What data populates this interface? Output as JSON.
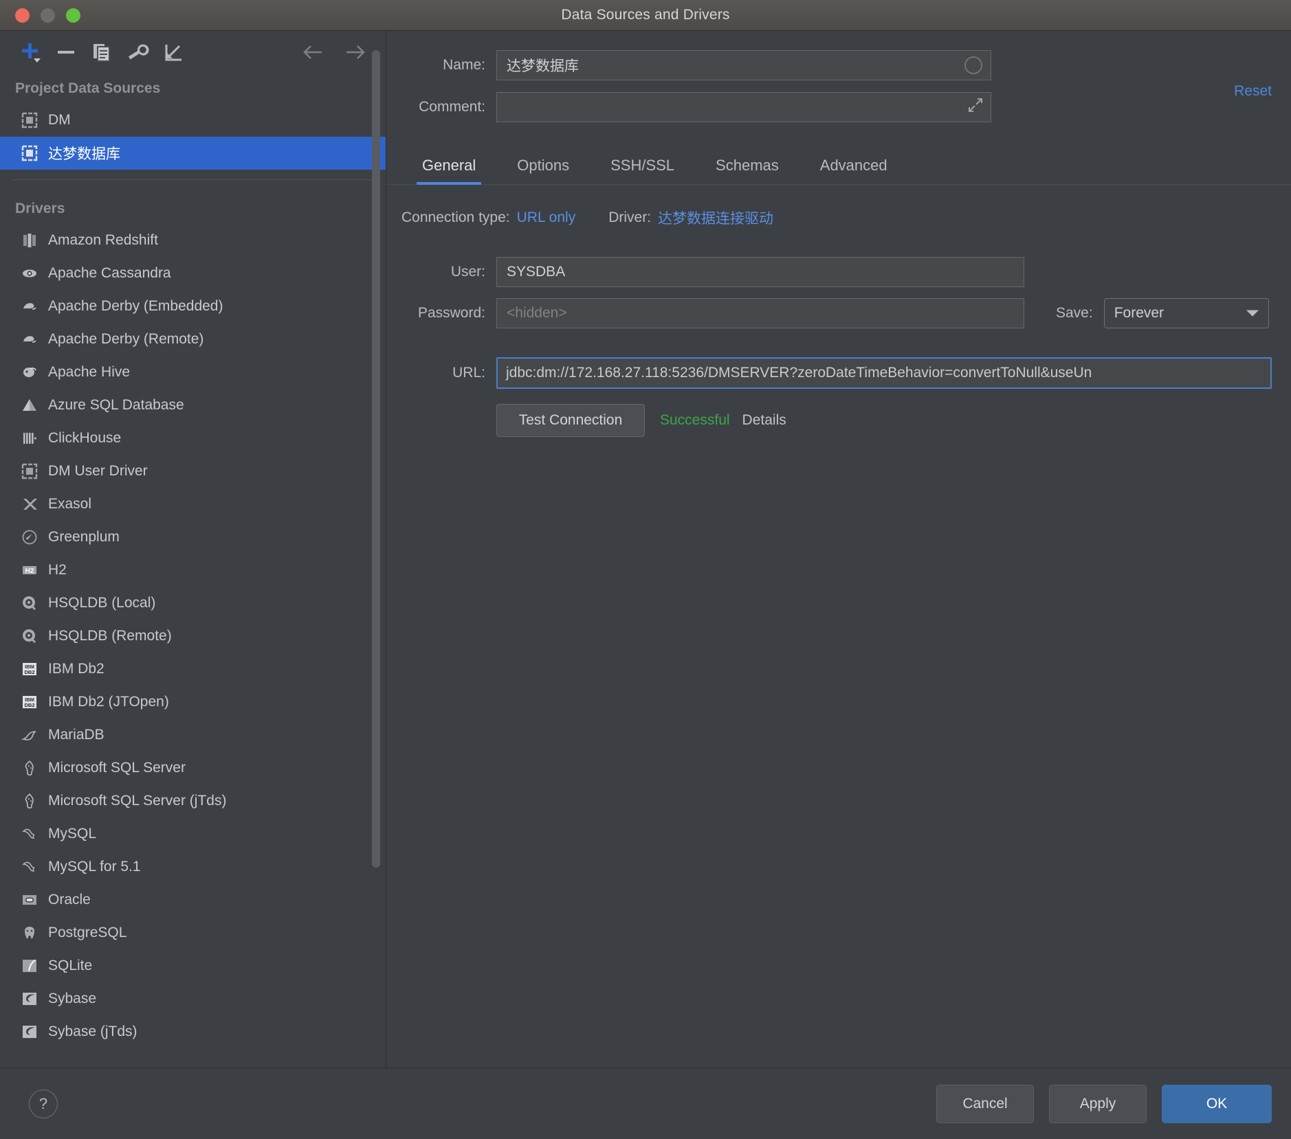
{
  "window": {
    "title": "Data Sources and Drivers",
    "traffic_lights": [
      "close",
      "minimize",
      "zoom"
    ]
  },
  "toolbar": {
    "icons": [
      {
        "name": "add-icon",
        "glyph": "+"
      },
      {
        "name": "remove-icon",
        "glyph": "−"
      },
      {
        "name": "copy-icon",
        "glyph": "copy"
      },
      {
        "name": "wrench-icon",
        "glyph": "wrench"
      },
      {
        "name": "import-icon",
        "glyph": "import"
      }
    ],
    "back_icon": "arrow-left-icon",
    "forward_icon": "arrow-right-icon"
  },
  "sidebar": {
    "project_group_label": "Project Data Sources",
    "project_items": [
      {
        "label": "DM",
        "icon": "dm-datasource-icon",
        "selected": false
      },
      {
        "label": "达梦数据库",
        "icon": "dm-datasource-icon",
        "selected": true
      }
    ],
    "drivers_group_label": "Drivers",
    "drivers": [
      {
        "label": "Amazon Redshift",
        "icon": "redshift-icon"
      },
      {
        "label": "Apache Cassandra",
        "icon": "cassandra-icon"
      },
      {
        "label": "Apache Derby (Embedded)",
        "icon": "derby-icon"
      },
      {
        "label": "Apache Derby (Remote)",
        "icon": "derby-icon"
      },
      {
        "label": "Apache Hive",
        "icon": "hive-icon"
      },
      {
        "label": "Azure SQL Database",
        "icon": "azure-icon"
      },
      {
        "label": "ClickHouse",
        "icon": "clickhouse-icon"
      },
      {
        "label": "DM User Driver",
        "icon": "dm-driver-icon"
      },
      {
        "label": "Exasol",
        "icon": "exasol-icon"
      },
      {
        "label": "Greenplum",
        "icon": "greenplum-icon"
      },
      {
        "label": "H2",
        "icon": "h2-icon"
      },
      {
        "label": "HSQLDB (Local)",
        "icon": "hsqldb-icon"
      },
      {
        "label": "HSQLDB (Remote)",
        "icon": "hsqldb-icon"
      },
      {
        "label": "IBM Db2",
        "icon": "db2-icon"
      },
      {
        "label": "IBM Db2 (JTOpen)",
        "icon": "db2-icon"
      },
      {
        "label": "MariaDB",
        "icon": "mariadb-icon"
      },
      {
        "label": "Microsoft SQL Server",
        "icon": "mssql-icon"
      },
      {
        "label": "Microsoft SQL Server (jTds)",
        "icon": "mssql-icon"
      },
      {
        "label": "MySQL",
        "icon": "mysql-icon"
      },
      {
        "label": "MySQL for 5.1",
        "icon": "mysql-icon"
      },
      {
        "label": "Oracle",
        "icon": "oracle-icon"
      },
      {
        "label": "PostgreSQL",
        "icon": "postgresql-icon"
      },
      {
        "label": "SQLite",
        "icon": "sqlite-icon"
      },
      {
        "label": "Sybase",
        "icon": "sybase-icon"
      },
      {
        "label": "Sybase (jTds)",
        "icon": "sybase-icon"
      }
    ]
  },
  "detail": {
    "reset_label": "Reset",
    "name_label": "Name:",
    "name_value": "达梦数据库",
    "comment_label": "Comment:",
    "comment_value": "",
    "comment_placeholder": "",
    "tabs": [
      {
        "label": "General",
        "active": true
      },
      {
        "label": "Options",
        "active": false
      },
      {
        "label": "SSH/SSL",
        "active": false
      },
      {
        "label": "Schemas",
        "active": false
      },
      {
        "label": "Advanced",
        "active": false
      }
    ],
    "connection_type_label": "Connection type:",
    "connection_type_value": "URL only",
    "driver_label": "Driver:",
    "driver_value": "达梦数据连接驱动",
    "user_label": "User:",
    "user_value": "SYSDBA",
    "password_label": "Password:",
    "password_placeholder": "<hidden>",
    "password_value": "",
    "save_label": "Save:",
    "save_value": "Forever",
    "url_label": "URL:",
    "url_value": "jdbc:dm://172.168.27.118:5236/DMSERVER?zeroDateTimeBehavior=convertToNull&useUn",
    "test_connection_label": "Test Connection",
    "test_status": "Successful",
    "details_label": "Details"
  },
  "footer": {
    "help_label": "?",
    "cancel_label": "Cancel",
    "apply_label": "Apply",
    "ok_label": "OK"
  },
  "colors": {
    "accent_blue": "#2f65ca",
    "link_blue": "#4d86de",
    "success_green": "#3ea548",
    "panel_bg": "#3c4045",
    "titlebar_bg": "#4e4a47",
    "focus_border": "#4b7fc4"
  }
}
